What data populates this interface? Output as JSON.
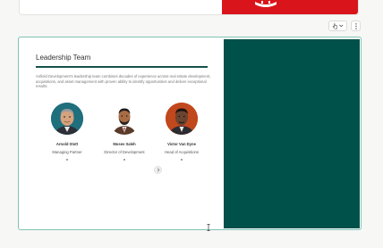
{
  "previous_slide": {
    "accent_color": "#d9141b"
  },
  "toolbar": {
    "items": [
      {
        "icon": "hand-pointer-icon",
        "has_dropdown": true
      },
      {
        "icon": "more-vertical-icon",
        "has_dropdown": false
      }
    ]
  },
  "slide": {
    "title": "Leadership Team",
    "description": "Anfield Development's leadership team combines decades of experience across real estate development, acquisitions, and asset management with proven ability to identify opportunities and deliver exceptional results.",
    "panel_color": "#00514a",
    "members": [
      {
        "name": "Arnold Stott",
        "role": "Managing Partner",
        "portrait_bg": "#1f6f7d"
      },
      {
        "name": "Moses Saleh",
        "role": "Director of Development",
        "portrait_bg": "#ffffff"
      },
      {
        "name": "Victor Van Dyne",
        "role": "Head of Acquisitions",
        "portrait_bg": "#c1471c"
      }
    ]
  }
}
